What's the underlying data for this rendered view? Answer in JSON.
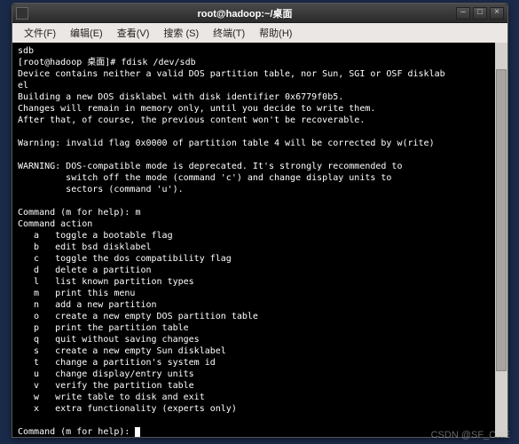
{
  "window": {
    "title": "root@hadoop:~/桌面"
  },
  "menu": [
    "文件(F)",
    "编辑(E)",
    "查看(V)",
    "搜索 (S)",
    "终端(T)",
    "帮助(H)"
  ],
  "term": {
    "l0": "sdb",
    "l1": "[root@hadoop 桌面]# fdisk /dev/sdb",
    "l2": "Device contains neither a valid DOS partition table, nor Sun, SGI or OSF disklab",
    "l3": "el",
    "l4": "Building a new DOS disklabel with disk identifier 0x6779f0b5.",
    "l5": "Changes will remain in memory only, until you decide to write them.",
    "l6": "After that, of course, the previous content won't be recoverable.",
    "l7": "",
    "l8": "Warning: invalid flag 0x0000 of partition table 4 will be corrected by w(rite)",
    "l9": "",
    "l10": "WARNING: DOS-compatible mode is deprecated. It's strongly recommended to",
    "l11": "         switch off the mode (command 'c') and change display units to",
    "l12": "         sectors (command 'u').",
    "l13": "",
    "l14": "Command (m for help): m",
    "l15": "Command action",
    "l16": "   a   toggle a bootable flag",
    "l17": "   b   edit bsd disklabel",
    "l18": "   c   toggle the dos compatibility flag",
    "l19": "   d   delete a partition",
    "l20": "   l   list known partition types",
    "l21": "   m   print this menu",
    "l22": "   n   add a new partition",
    "l23": "   o   create a new empty DOS partition table",
    "l24": "   p   print the partition table",
    "l25": "   q   quit without saving changes",
    "l26": "   s   create a new empty Sun disklabel",
    "l27": "   t   change a partition's system id",
    "l28": "   u   change display/entry units",
    "l29": "   v   verify the partition table",
    "l30": "   w   write table to disk and exit",
    "l31": "   x   extra functionality (experts only)",
    "l32": "",
    "l33": "Command (m for help): "
  },
  "watermark": "CSDN @SF_ONE"
}
